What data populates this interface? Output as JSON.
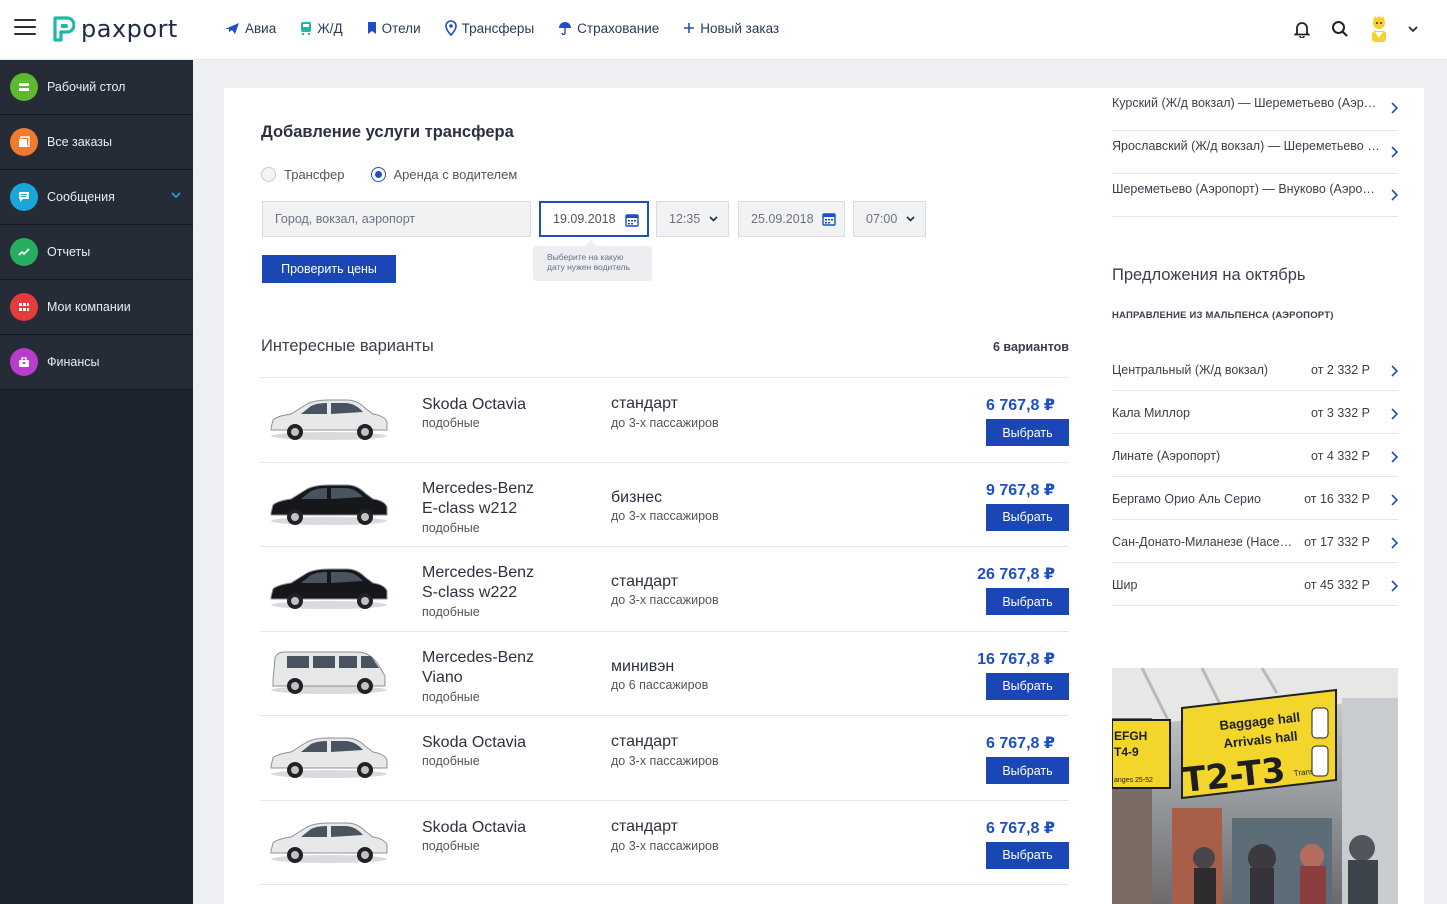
{
  "brand": {
    "name": "paxport",
    "color": "#1fb8a6"
  },
  "nav": [
    {
      "label": "Авиа",
      "icon": "plane-icon"
    },
    {
      "label": "Ж/Д",
      "icon": "train-icon"
    },
    {
      "label": "Отели",
      "icon": "hotel-icon"
    },
    {
      "label": "Трансферы",
      "icon": "location-pin-icon"
    },
    {
      "label": "Страхование",
      "icon": "umbrella-icon"
    },
    {
      "label": "Новый заказ",
      "icon": "plus-icon"
    }
  ],
  "sidebar": {
    "items": [
      {
        "label": "Рабочий стол",
        "color": "#5cba2f",
        "icon": "desktop-icon"
      },
      {
        "label": "Все заказы",
        "color": "#ef7b2e",
        "icon": "orders-icon"
      },
      {
        "label": "Сообщения",
        "color": "#19a7d9",
        "icon": "chat-icon"
      },
      {
        "label": "Отчеты",
        "color": "#27ae60",
        "icon": "chart-icon"
      },
      {
        "label": "Мои компании",
        "color": "#e73a3a",
        "icon": "grid-icon"
      },
      {
        "label": "Финансы",
        "color": "#b93ccd",
        "icon": "wallet-icon"
      }
    ]
  },
  "form": {
    "title": "Добавление услуги трансфера",
    "radio_transfer": "Трансфер",
    "radio_rent": "Аренда с водителем",
    "place_placeholder": "Город, вокзал, аэропорт",
    "date_from": "19.09.2018",
    "time_from": "12:35",
    "date_to": "25.09.2018",
    "time_to": "07:00",
    "tooltip": "Выберите на какую дату нужен водитель",
    "check_button": "Проверить цены"
  },
  "variants": {
    "title": "Интересные варианты",
    "count": "6 вариантов",
    "select_label": "Выбрать",
    "rows": [
      {
        "name": "Skoda Octavia",
        "sub": "подобные",
        "cls": "стандарт",
        "pax": "до 3-х пассажиров",
        "price": "6 767,8 ₽",
        "color": "#e6e8ea"
      },
      {
        "name": "Mercedes-Benz E-class w212",
        "sub": "подобные",
        "cls": "бизнес",
        "pax": "до 3-х пассажиров",
        "price": "9 767,8 ₽",
        "color": "#15171b"
      },
      {
        "name": "Mercedes-Benz S-class w222",
        "sub": "подобные",
        "cls": "стандарт",
        "pax": "до 3-х пассажиров",
        "price": "26 767,8 ₽",
        "color": "#15171b"
      },
      {
        "name": "Mercedes-Benz Viano",
        "sub": "подобные",
        "cls": "минивэн",
        "pax": "до 6 пассажиров",
        "price": "16 767,8 ₽",
        "color": "#e6e8ea"
      },
      {
        "name": "Skoda Octavia",
        "sub": "подобные",
        "cls": "стандарт",
        "pax": "до 3-х пассажиров",
        "price": "6 767,8 ₽",
        "color": "#e6e8ea"
      },
      {
        "name": "Skoda Octavia",
        "sub": "подобные",
        "cls": "стандарт",
        "pax": "до 3-х пассажиров",
        "price": "6 767,8 ₽",
        "color": "#e6e8ea"
      }
    ]
  },
  "routes": [
    "Курский (Ж/д вокзал) — Шереметьево (Аэропорт)",
    "Ярославский (Ж/д вокзал) — Шереметьево (Аэропорт)",
    "Шереметьево (Аэропорт) — Внуково (Аэропорт)"
  ],
  "offers": {
    "title": "Предложения на октябрь",
    "subtitle": "НАПРАВЛЕНИЕ ИЗ МАЛЬПЕНСА (АЭРОПОРТ)",
    "items": [
      {
        "name": "Центральный (Ж/д вокзал)",
        "price": "от 2 332 Р"
      },
      {
        "name": "Кала Миллор",
        "price": "от 3 332 Р"
      },
      {
        "name": "Линате (Аэропорт)",
        "price": "от 4 332 Р"
      },
      {
        "name": "Бергамо Орио Аль Серио",
        "price": "от 16 332 Р"
      },
      {
        "name": "Сан-Донато-Миланезе (Насерия)",
        "price": "от 17 332 Р"
      },
      {
        "name": "Шир",
        "price": "от 45 332 Р"
      }
    ]
  },
  "photo": {
    "sign_line1": "Baggage hall",
    "sign_line2": "Arrivals hall",
    "sign_big": "T2-T3",
    "sign_small": "Transfer",
    "sign_left1": "EFGH",
    "sign_left2": "T4-9",
    "sign_left3": "anges 25-52"
  }
}
